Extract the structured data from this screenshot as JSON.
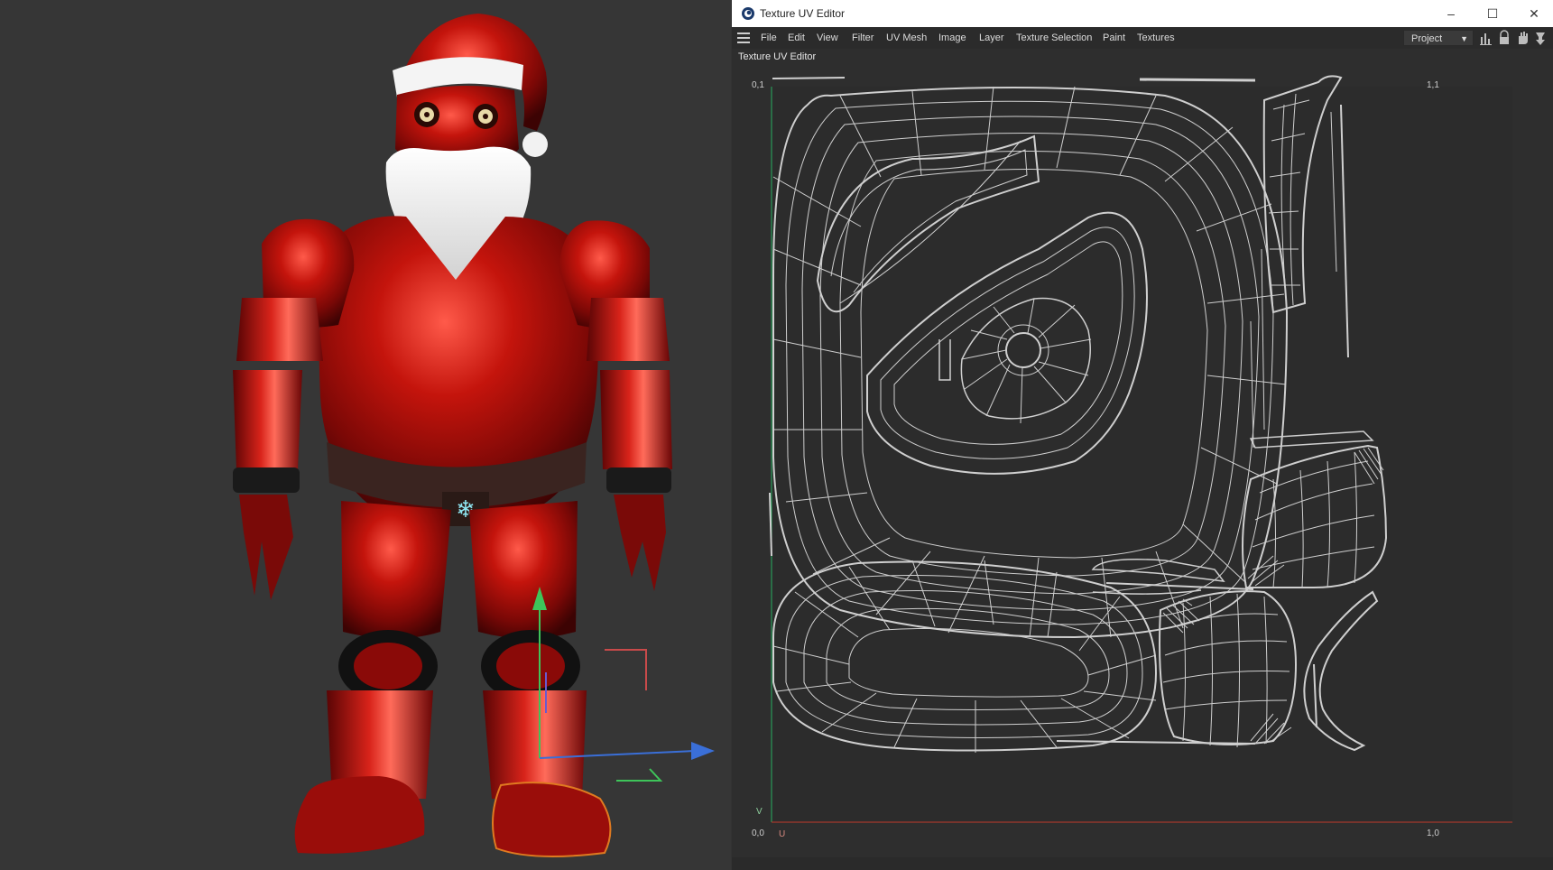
{
  "viewport": {
    "background": "#363636",
    "gizmo": {
      "x_color": "#3a6fd8",
      "y_color": "#3ec45a",
      "z_color": "#d84a4a"
    }
  },
  "uv_editor": {
    "window_title": "Texture UV Editor",
    "menu": [
      "File",
      "Edit",
      "View",
      "Filter",
      "UV Mesh",
      "Image",
      "Layer",
      "Texture Selection",
      "Paint",
      "Textures"
    ],
    "project_select": {
      "value": "Project"
    },
    "panel_title": "Texture UV Editor",
    "corners": {
      "top_left": "0,1",
      "top_right": "1,1",
      "bottom_left": "0,0",
      "bottom_right": "1,0"
    },
    "axis_v": "V",
    "axis_u": "U",
    "colors": {
      "wire": "#cfcfcf",
      "u_axis": "#c0392b",
      "v_axis": "#27ae60"
    }
  }
}
